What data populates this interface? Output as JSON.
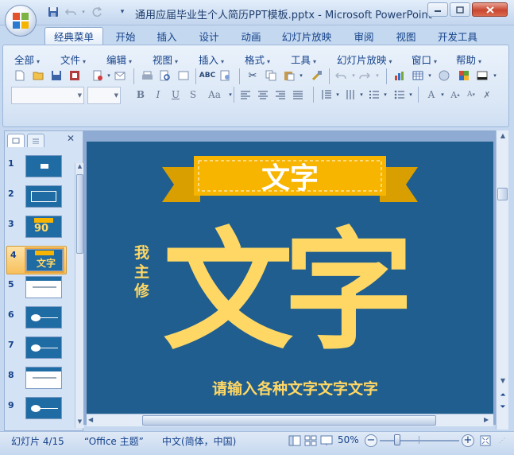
{
  "window": {
    "title": "通用应届毕业生个人简历PPT模板.pptx - Microsoft PowerPoint",
    "qat_icons": [
      "save-icon",
      "undo-icon",
      "redo-icon",
      "customize-qat-icon"
    ]
  },
  "tabs": [
    "经典菜单",
    "开始",
    "插入",
    "设计",
    "动画",
    "幻灯片放映",
    "审阅",
    "视图",
    "开发工具"
  ],
  "menus": [
    "全部",
    "文件",
    "编辑",
    "视图",
    "插入",
    "格式",
    "工具",
    "幻灯片放映",
    "窗口",
    "帮助"
  ],
  "menu_dropdown_glyph": "▾",
  "left_pane": {
    "close_glyph": "✕",
    "thumbs": [
      {
        "num": "1",
        "text": ""
      },
      {
        "num": "2",
        "text": ""
      },
      {
        "num": "3",
        "text": "90"
      },
      {
        "num": "4",
        "text": "文字"
      },
      {
        "num": "5",
        "text": ""
      },
      {
        "num": "6",
        "text": ""
      },
      {
        "num": "7",
        "text": ""
      },
      {
        "num": "8",
        "text": ""
      },
      {
        "num": "9",
        "text": ""
      }
    ]
  },
  "slide": {
    "ribbon_text": "文字",
    "side_text": "我主修",
    "big_text": "文字",
    "subtitle": "请输入各种文字文字文字",
    "colors": {
      "background": "#1f5e8e",
      "ribbon": "#f7b500",
      "text": "#ffd765"
    }
  },
  "status": {
    "slide_info": "幻灯片 4/15",
    "theme": "“Office 主题”",
    "language": "中文(简体，中国)",
    "zoom": "50%",
    "zoom_level": 0.5
  }
}
